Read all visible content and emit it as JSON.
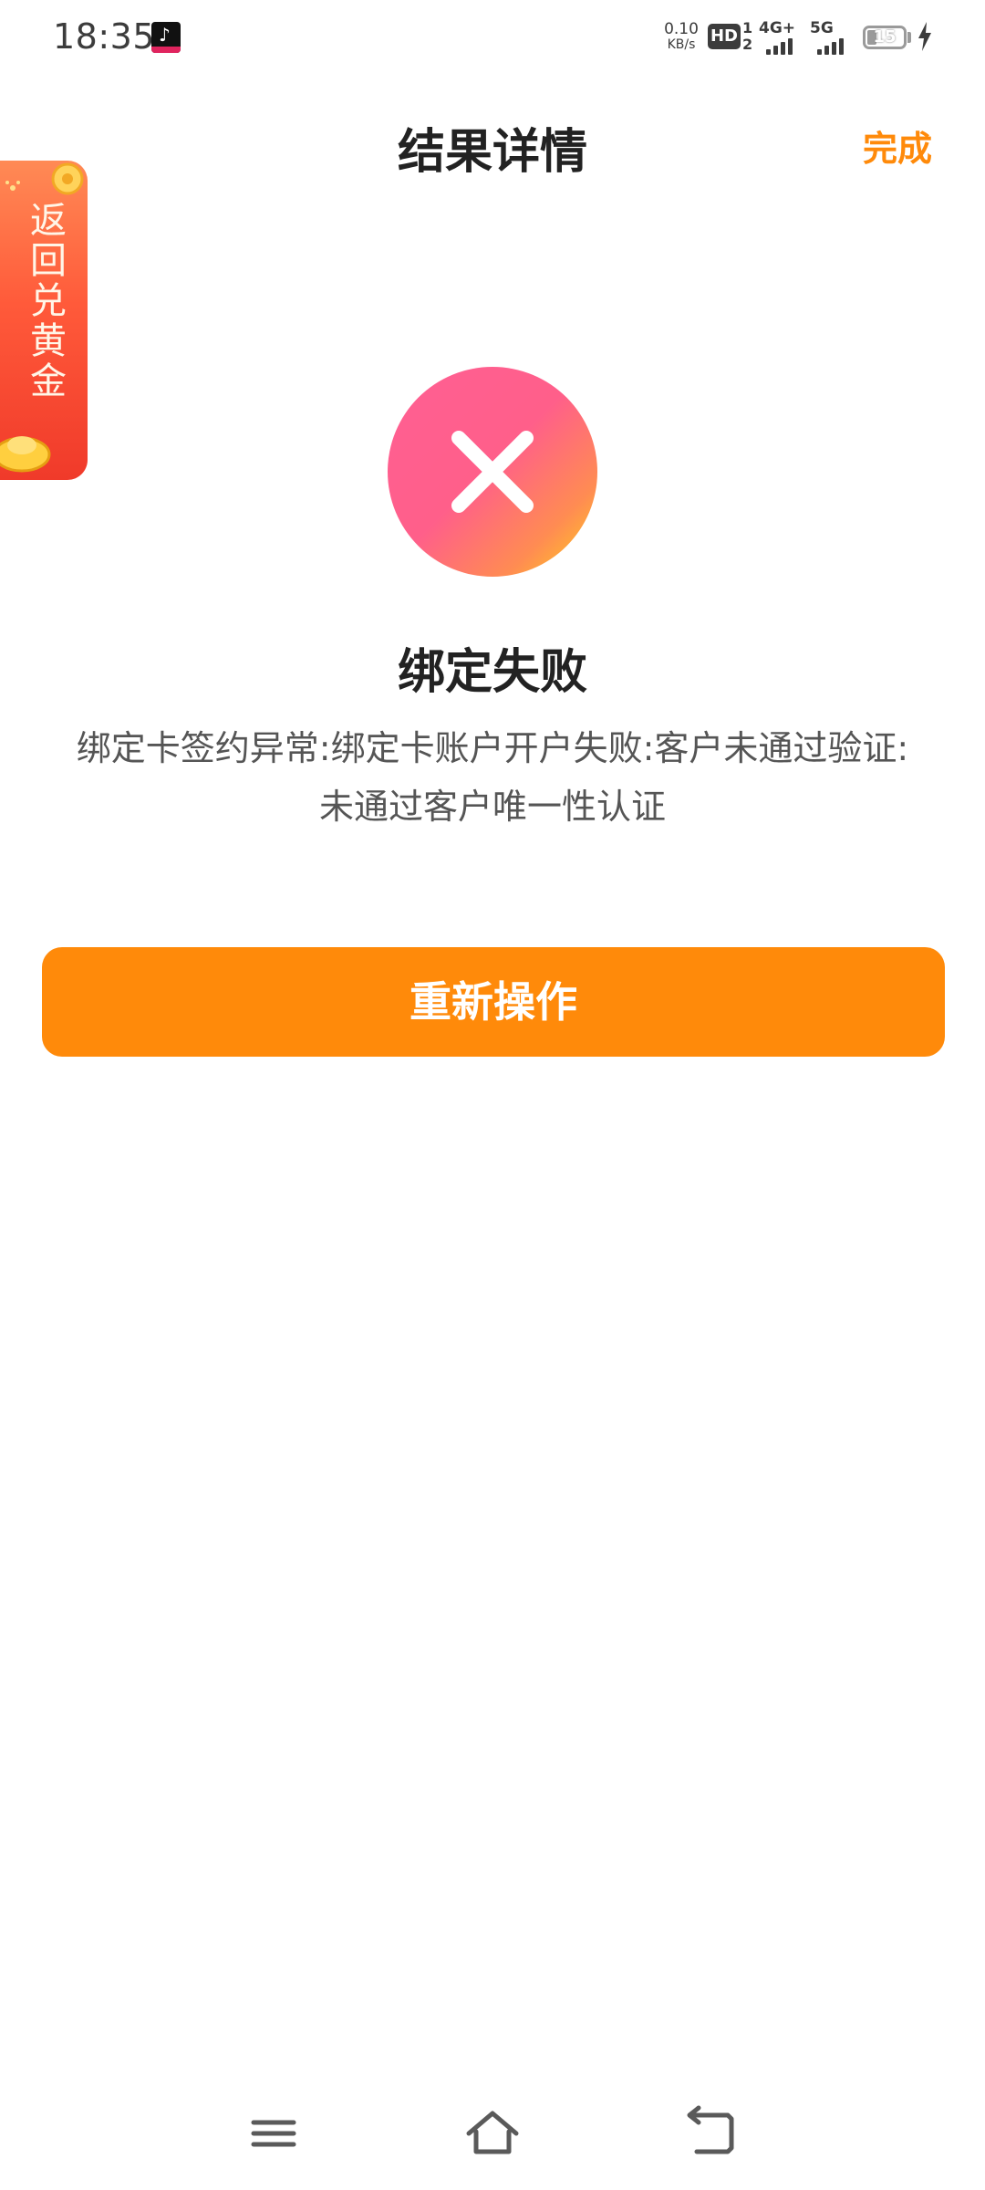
{
  "status_bar": {
    "time": "18:35",
    "net_speed_value": "0.10",
    "net_speed_unit": "KB/s",
    "hd_label": "HD",
    "hd_sub_top": "1",
    "hd_sub_bottom": "2",
    "sim1_label": "4G+",
    "sim2_label": "5G",
    "battery_level": "15",
    "app_icon": "tiktok-icon"
  },
  "header": {
    "title": "结果详情",
    "done_label": "完成"
  },
  "side_banner": {
    "text": "返回兑黄金"
  },
  "result": {
    "status_icon": "error-x-icon",
    "title": "绑定失败",
    "message_line1": "绑定卡签约异常:绑定卡账户开户失败:客户未通过验证:",
    "message_line2": "未通过客户唯一性认证"
  },
  "actions": {
    "retry_label": "重新操作"
  },
  "nav_bar": {
    "menu_icon": "menu-icon",
    "home_icon": "home-icon",
    "back_icon": "back-icon"
  },
  "colors": {
    "accent": "#FF8A0A",
    "error_gradient_start": "#FF5F93",
    "error_gradient_end": "#FFD21A"
  }
}
